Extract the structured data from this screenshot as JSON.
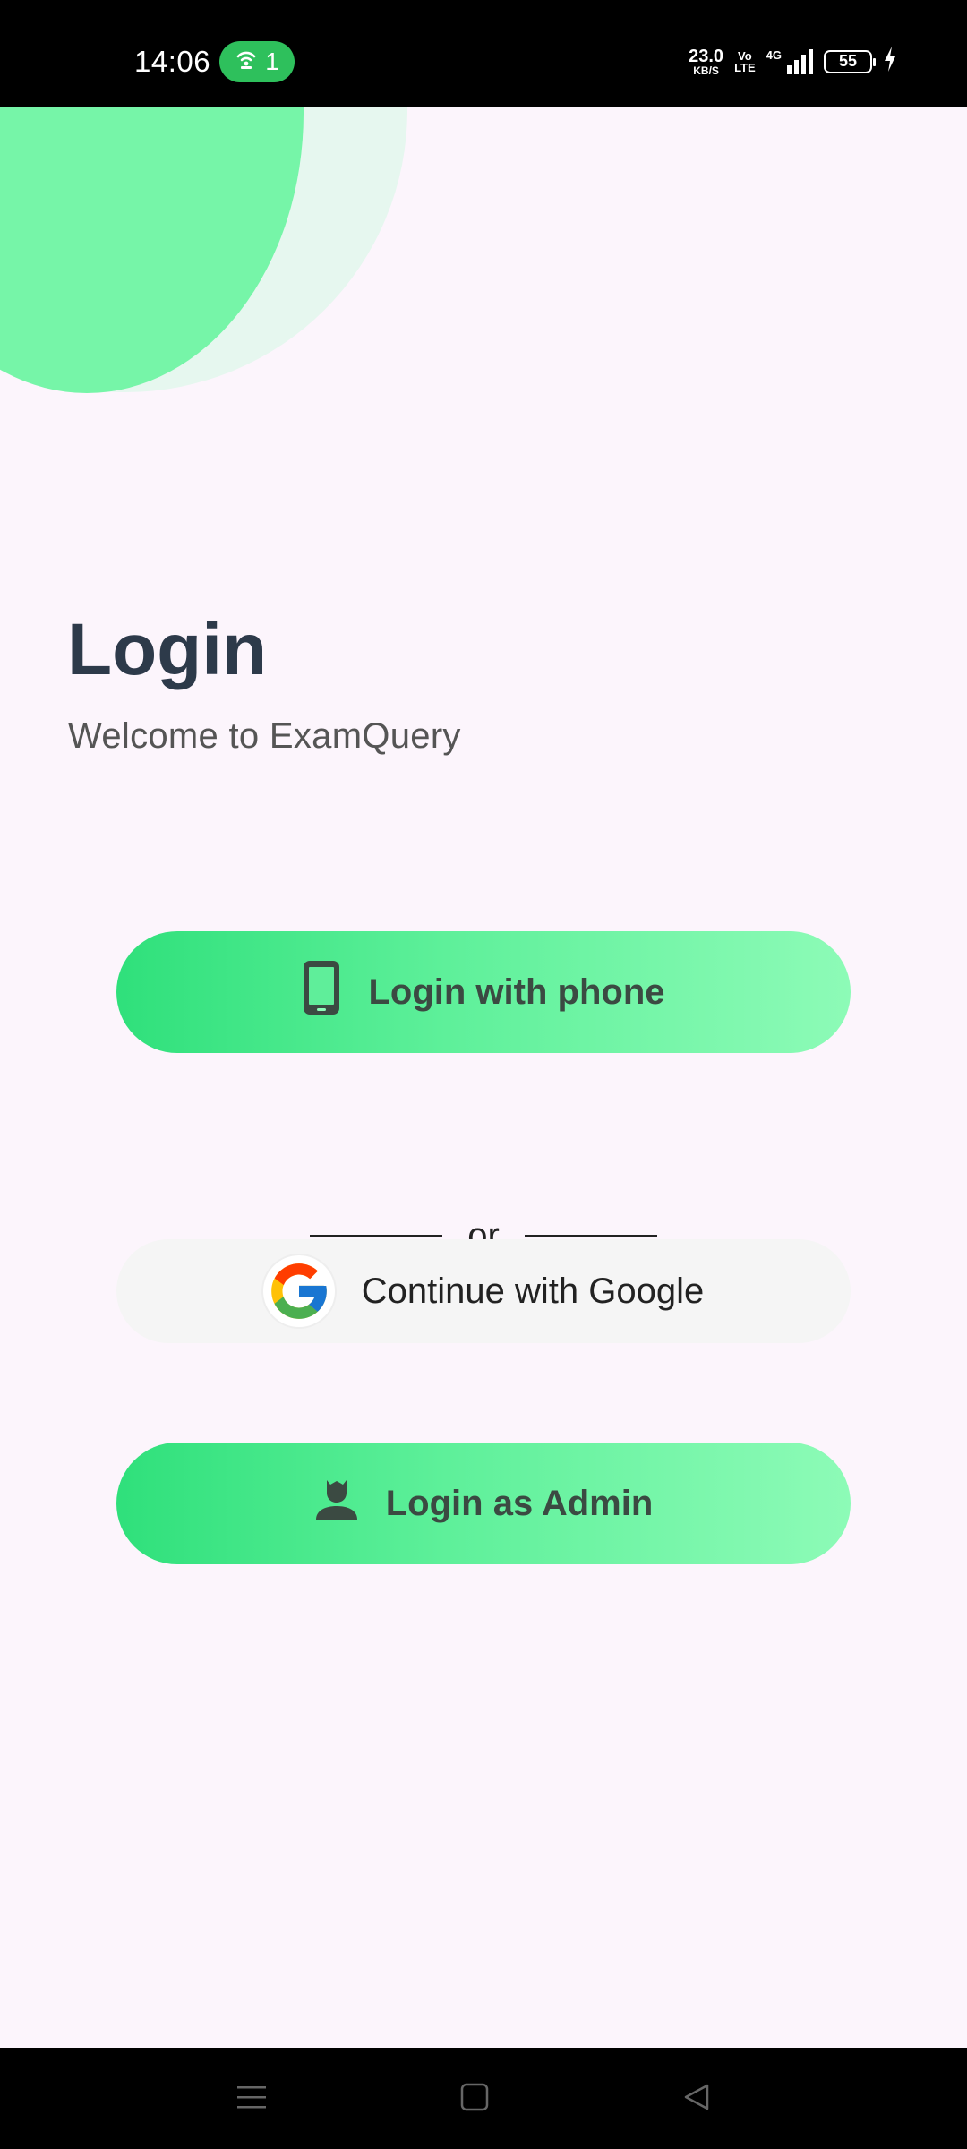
{
  "status_bar": {
    "time": "14:06",
    "hotspot_count": "1",
    "net_speed_value": "23.0",
    "net_speed_unit": "KB/S",
    "volte_top": "Vo",
    "volte_bottom": "LTE",
    "network_type": "4G",
    "battery_level": "55",
    "icons": [
      "hotspot-icon",
      "signal-icon",
      "battery-icon",
      "charging-icon"
    ]
  },
  "header": {
    "title": "Login",
    "subtitle": "Welcome to ExamQuery"
  },
  "actions": {
    "phone_label": "Login with phone",
    "or_label": "or",
    "google_label": "Continue with Google",
    "admin_label": "Login as Admin"
  },
  "nav_bar": {
    "icons": [
      "menu-icon",
      "home-icon",
      "back-icon"
    ]
  },
  "colors": {
    "background": "#fcf5fc",
    "accent_green": "#2fe07b",
    "accent_green_light": "#8dfbb7",
    "title_text": "#2d3a4a",
    "decor_circle": "#76f5a8",
    "decor_circle_outer": "#e6f7ef"
  }
}
